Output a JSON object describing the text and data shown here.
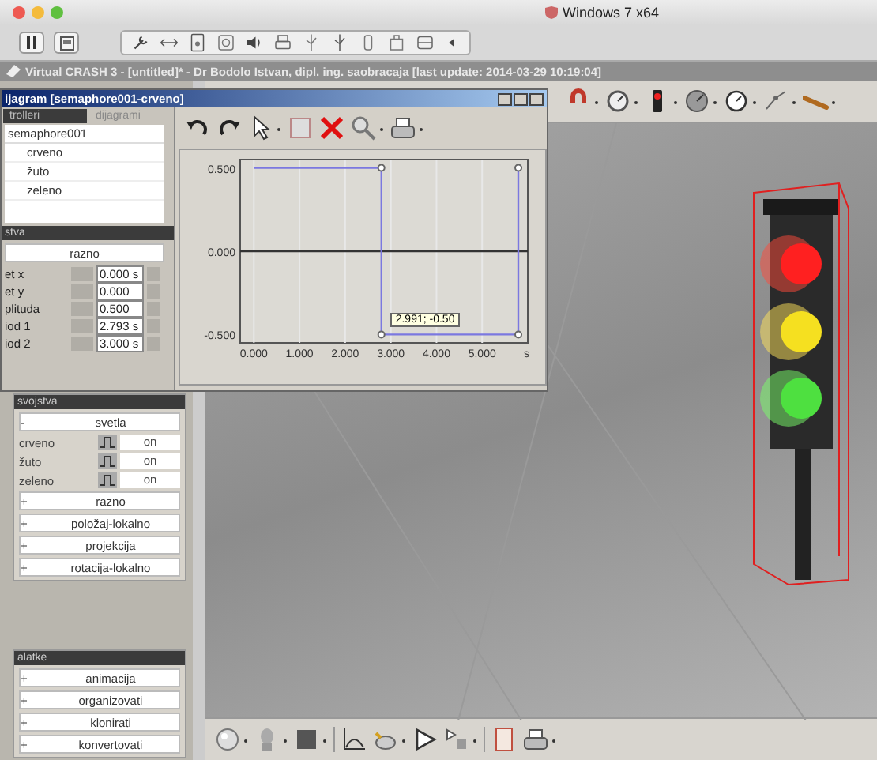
{
  "host_window": {
    "title": "Windows 7 x64"
  },
  "app_window": {
    "title": "Virtual CRASH 3 - [untitled]* - Dr Bodolo Istvan, dipl. ing. saobracaja [last update: 2014-03-29 10:19:04]"
  },
  "diagram_window": {
    "title": "ijagram [semaphore001-crveno]",
    "tabs": [
      {
        "label": "trolleri",
        "selected": true
      },
      {
        "label": "dijagrami",
        "selected": false
      }
    ],
    "tree": {
      "label": "semaphore001",
      "children": [
        {
          "label": "crveno"
        },
        {
          "label": "žuto"
        },
        {
          "label": "zeleno"
        }
      ]
    },
    "properties": {
      "header": "stva",
      "group": "razno",
      "fields": [
        {
          "label": "et x",
          "value": "0.000 s"
        },
        {
          "label": "et y",
          "value": "0.000"
        },
        {
          "label": "plituda",
          "value": "0.500"
        },
        {
          "label": "iod 1",
          "value": "2.793 s"
        },
        {
          "label": "iod 2",
          "value": "3.000 s"
        }
      ]
    },
    "chart": {
      "tooltip": "2.991; -0.50",
      "chart_data": {
        "type": "line",
        "xlabel": "s",
        "x": [
          0,
          2.793,
          2.793,
          5.793,
          5.793
        ],
        "grid": true,
        "series": [
          {
            "color": "#7b78e0",
            "marker": "o",
            "values": [
              0.5,
              0.5,
              -0.5,
              -0.5,
              0.5
            ]
          }
        ],
        "xlim": [
          -0.3,
          6.0
        ],
        "ylim": [
          -0.55,
          0.55
        ],
        "xticks": [
          {
            "value": 0,
            "label": "0.000"
          },
          {
            "value": 1,
            "label": "1.000"
          },
          {
            "value": 2,
            "label": "2.000"
          },
          {
            "value": 3,
            "label": "3.000"
          },
          {
            "value": 4,
            "label": "4.000"
          },
          {
            "value": 5,
            "label": "5.000"
          }
        ],
        "yticks": [
          {
            "value": 0.5,
            "label": "0.500"
          },
          {
            "value": 0,
            "label": "0.000"
          },
          {
            "value": -0.5,
            "label": "-0.500"
          }
        ]
      }
    }
  },
  "left_panel": {
    "properties": {
      "header": "svojstva",
      "group": {
        "sign": "-",
        "label": "svetla"
      },
      "lights": [
        {
          "label": "crveno",
          "value": "on"
        },
        {
          "label": "žuto",
          "value": "on"
        },
        {
          "label": "zeleno",
          "value": "on"
        }
      ],
      "groups": [
        {
          "sign": "+",
          "label": "razno"
        },
        {
          "sign": "+",
          "label": "položaj-lokalno"
        },
        {
          "sign": "+",
          "label": "projekcija"
        },
        {
          "sign": "+",
          "label": "rotacija-lokalno"
        }
      ]
    },
    "tools": {
      "header": "alatke",
      "groups": [
        {
          "sign": "+",
          "label": "animacija"
        },
        {
          "sign": "+",
          "label": "organizovati"
        },
        {
          "sign": "+",
          "label": "klonirati"
        },
        {
          "sign": "+",
          "label": "konvertovati"
        }
      ]
    }
  }
}
